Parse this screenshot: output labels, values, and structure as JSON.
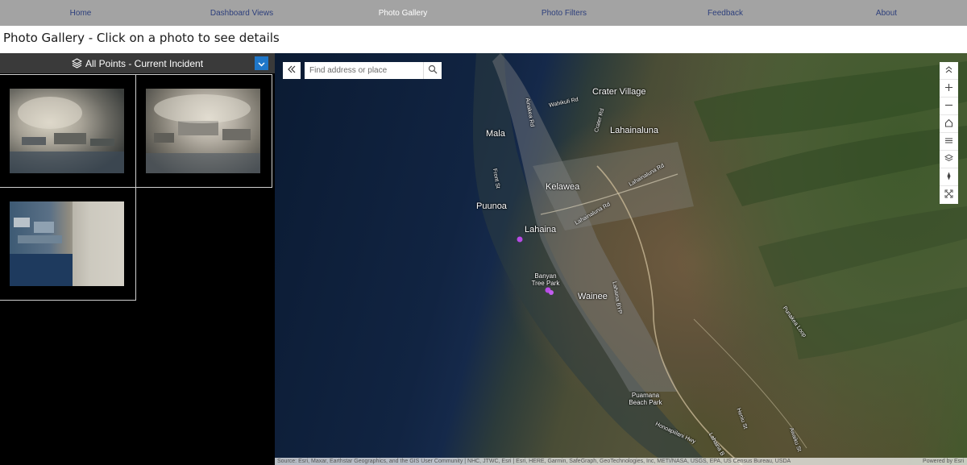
{
  "nav": {
    "items": [
      {
        "label": "Home",
        "active": false
      },
      {
        "label": "Dashboard Views",
        "active": false
      },
      {
        "label": "Photo Gallery",
        "active": true
      },
      {
        "label": "Photo Filters",
        "active": false
      },
      {
        "label": "Feedback",
        "active": false
      },
      {
        "label": "About",
        "active": false
      }
    ]
  },
  "page": {
    "title": "Photo Gallery - Click on a photo to see details"
  },
  "gallery": {
    "header_label": "All Points - Current Incident",
    "icons": {
      "layers": "layers-icon",
      "dropdown": "chevron-down-icon"
    }
  },
  "map": {
    "search_placeholder": "Find address or place",
    "labels": {
      "crater_village": "Crater Village",
      "wahikuli_rd": "Wahikuli Rd",
      "ainakea_rd": "Ainakea Rd",
      "mala": "Mala",
      "crater_rd": "Crater Rd",
      "lahainaluna": "Lahainaluna",
      "front_st": "Front St",
      "kelawea": "Kelawea",
      "lahainaluna_rd": "Lahainaluna Rd",
      "puunoa": "Puunoa",
      "lahaina": "Lahaina",
      "banyan_tree_park": "Banyan Tree Park",
      "wainee": "Wainee",
      "lahaina_byp": "Lahaina BYP",
      "punakea_loop": "Punakea Loop",
      "puamana_beach_park": "Puamana Beach Park",
      "honoapiilani_hwy": "Honoapiilani Hwy",
      "heniu_st": "Heniu St",
      "lahaina_bp": "Lahaina B",
      "awaiku_st": "Awaiku St"
    },
    "attribution": "Source: Esri, Maxar, Earthstar Geographics, and the GIS User Community | NHC, JTWC, Esri | Esri, HERE, Garmin, SafeGraph, GeoTechnologies, Inc, METI/NASA, USGS, EPA, US Census Bureau, USDA",
    "powered_by": "Powered by Esri",
    "tool_icons": [
      "chevrons-up-icon",
      "zoom-in-icon",
      "zoom-out-icon",
      "home-icon",
      "list-icon",
      "layers-icon",
      "compass-icon",
      "fullscreen-icon"
    ],
    "marker_color": "#b84be6"
  }
}
